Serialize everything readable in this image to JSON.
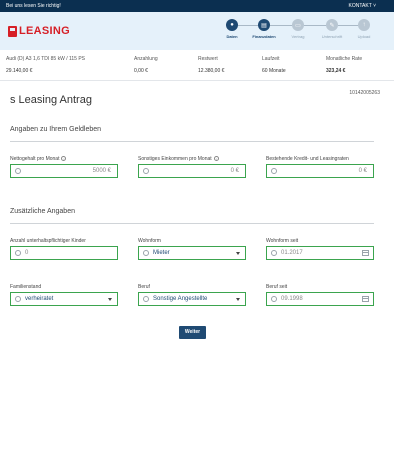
{
  "topbar": {
    "left_text": "Bei uns lesen Sie richtig!",
    "right_text": "KONTAKT ˅"
  },
  "logo": {
    "text": "LEASING"
  },
  "steps": [
    {
      "label": "Daten",
      "state": "active",
      "icon": "person-icon",
      "glyph": "●"
    },
    {
      "label": "Finanzdaten",
      "state": "active",
      "icon": "calculator-icon",
      "glyph": "▤"
    },
    {
      "label": "Vertrag",
      "state": "inactive",
      "icon": "document-icon",
      "glyph": "▭"
    },
    {
      "label": "Unterschrift",
      "state": "inactive",
      "icon": "signature-icon",
      "glyph": "✎"
    },
    {
      "label": "Upload",
      "state": "inactive",
      "icon": "upload-icon",
      "glyph": "↑"
    }
  ],
  "summary": {
    "vehicle": "Audi (D) A3 1,6 TDI 85 kW / 115 PS",
    "price": "29.140,00 €",
    "anzahlung_label": "Anzahlung",
    "anzahlung_value": "0,00 €",
    "restwert_label": "Restwert",
    "restwert_value": "12.380,00 €",
    "laufzeit_label": "Laufzeit",
    "laufzeit_value": "60 Monate",
    "rate_label": "Monatliche Rate",
    "rate_value": "323,24 €"
  },
  "page": {
    "title": "s Leasing Antrag",
    "reference": "10142005263"
  },
  "section1": {
    "title": "Angaben zu Ihrem Geldleben",
    "net_label": "Nettogehalt pro Monat",
    "net_value": "5000 €",
    "other_income_label": "Sonstiges Einkommen pro Monat",
    "other_income_value": "0 €",
    "existing_loans_label": "Bestehende Kredit- und Leasingraten",
    "existing_loans_value": "0 €"
  },
  "section2": {
    "title": "Zusätzliche Angaben",
    "children_label": "Anzahl unterhaltspflichtiger Kinder",
    "children_value": "0",
    "housing_label": "Wohnform",
    "housing_value": "Mieter",
    "housing_since_label": "Wohnform seit",
    "housing_since_value": "01.2017",
    "marital_label": "Familienstand",
    "marital_value": "verheiratet",
    "job_label": "Beruf",
    "job_value": "Sonstige Angestellte",
    "job_since_label": "Beruf seit",
    "job_since_value": "09.1998"
  },
  "actions": {
    "next_label": "Weiter"
  },
  "colors": {
    "primary": "#1f4a73",
    "brand_red": "#d61f26",
    "field_border": "#3ba44e",
    "header_bg": "#e5f1fa"
  }
}
